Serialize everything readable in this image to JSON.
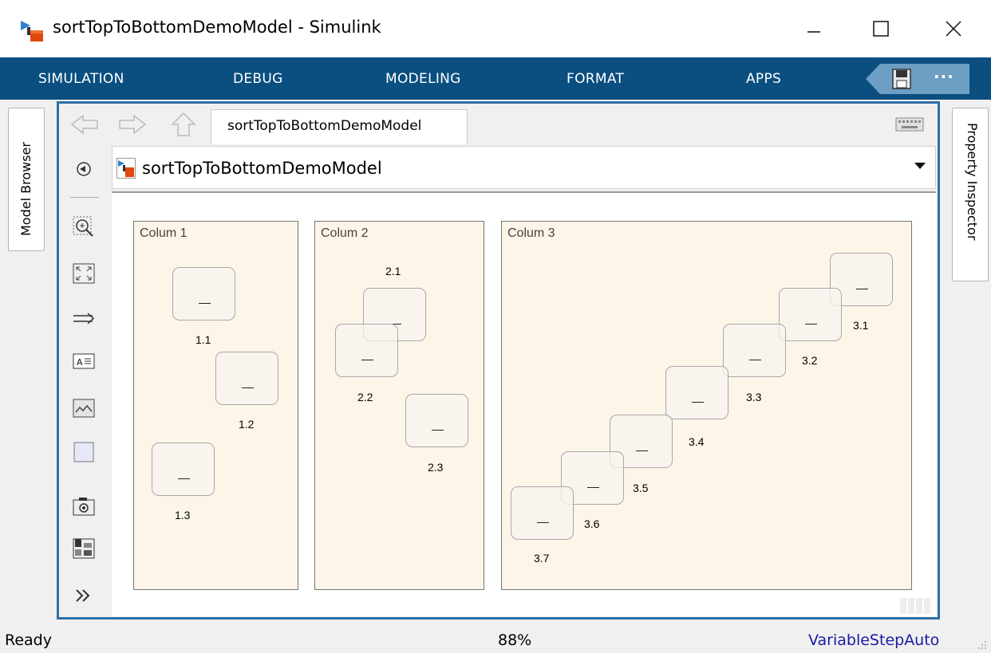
{
  "window": {
    "title": "sortTopToBottomDemoModel - Simulink",
    "minimize_icon": "minimize-icon",
    "maximize_icon": "maximize-icon",
    "close_icon": "close-icon"
  },
  "ribbon": {
    "tabs": [
      "SIMULATION",
      "DEBUG",
      "MODELING",
      "FORMAT",
      "APPS"
    ],
    "save_icon": "save-icon",
    "more_label": "···",
    "color": "#0a4f80"
  },
  "side_panels": {
    "left": "Model Browser",
    "right": "Property Inspector"
  },
  "editor": {
    "tab_label": "sortTopToBottomDemoModel",
    "address": "sortTopToBottomDemoModel",
    "palette_icons": [
      "hide-browser-icon",
      "zoom-icon",
      "fit-view-icon",
      "signal-arrow-icon",
      "annotation-icon",
      "image-icon",
      "area-icon",
      "screenshot-icon",
      "block-library-icon",
      "expand-palette-icon"
    ]
  },
  "diagram": {
    "areas": [
      {
        "label": "Colum 1",
        "blocks": [
          "1.1",
          "1.2",
          "1.3"
        ]
      },
      {
        "label": "Colum 2",
        "blocks": [
          "2.1",
          "2.2",
          "2.3"
        ]
      },
      {
        "label": "Colum 3",
        "blocks": [
          "3.1",
          "3.2",
          "3.3",
          "3.4",
          "3.5",
          "3.6",
          "3.7"
        ]
      }
    ],
    "area_fill": "#fdf5e8"
  },
  "status": {
    "state": "Ready",
    "zoom": "88%",
    "solver": "VariableStepAuto"
  }
}
